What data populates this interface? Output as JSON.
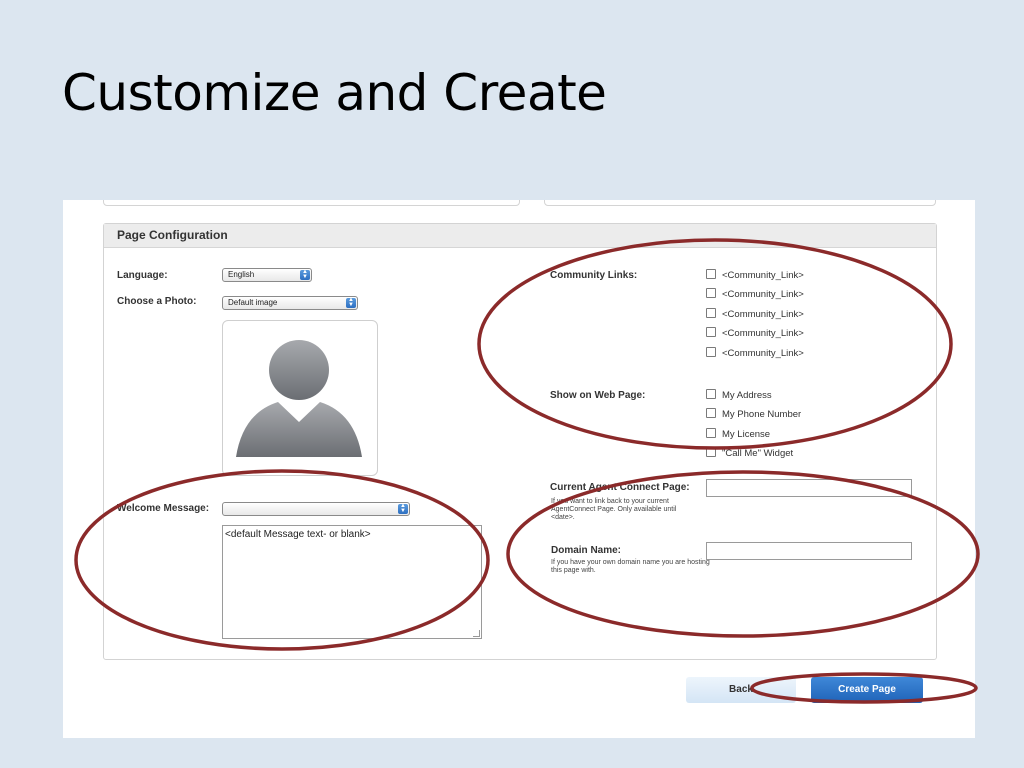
{
  "slide": {
    "title": "Customize and Create"
  },
  "panel": {
    "header": "Page Configuration"
  },
  "left": {
    "language_label": "Language:",
    "language_value": "English",
    "photo_label": "Choose a Photo:",
    "photo_value": "Default image",
    "welcome_label": "Welcome Message:",
    "welcome_select_value": "",
    "welcome_text": "<default Message text- or blank>"
  },
  "right": {
    "community_label": "Community Links:",
    "community_links": [
      "<Community_Link>",
      "<Community_Link>",
      "<Community_Link>",
      "<Community_Link>",
      "<Community_Link>"
    ],
    "show_label": "Show on Web Page:",
    "show_items": [
      "My Address",
      "My Phone Number",
      "My License",
      "\"Call Me\" Widget"
    ],
    "current_label": "Current  Agent Connect Page:",
    "current_help": "If you want to link back to your current AgentConnect Page. Only available until <date>.",
    "domain_label": "Domain Name:",
    "domain_help": "If you have your own domain name you are hosting this page with."
  },
  "buttons": {
    "back": "Back",
    "create": "Create Page"
  },
  "colors": {
    "annotation": "#8b2a2a",
    "primary": "#2a6fc4",
    "slide_bg": "#dce6f0"
  }
}
